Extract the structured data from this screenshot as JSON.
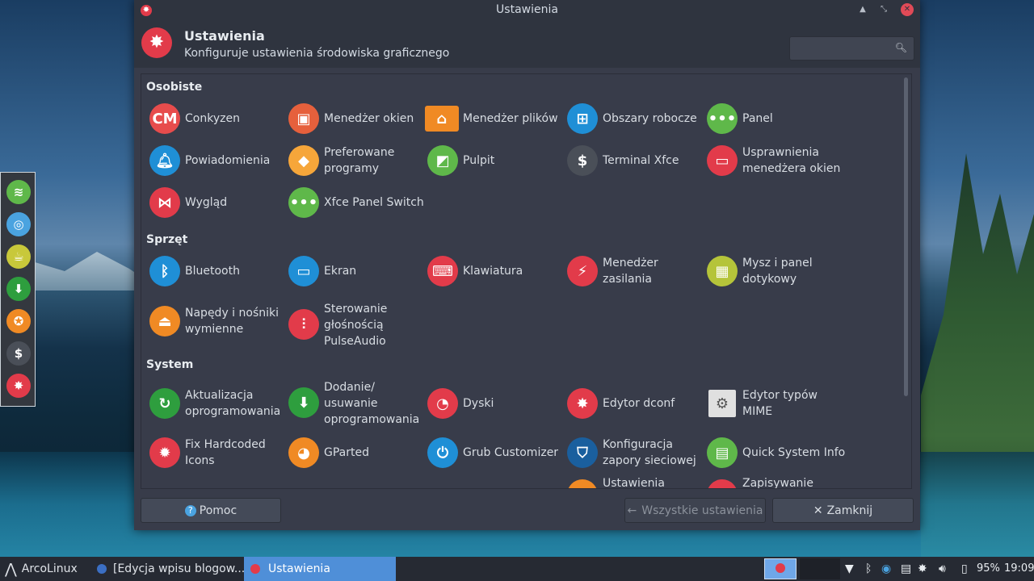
{
  "window": {
    "title": "Ustawienia",
    "header_title": "Ustawienia",
    "header_subtitle": "Konfiguruje ustawienia środowiska graficznego"
  },
  "search": {
    "placeholder": ""
  },
  "categories": [
    {
      "name": "Osobiste"
    },
    {
      "name": "Sprzęt"
    },
    {
      "name": "System"
    }
  ],
  "items": [
    {
      "label": "Conkyzen",
      "icon": "conkyzen-icon",
      "color": "#e74c4c"
    },
    {
      "label": "Menedżer okien",
      "icon": "window-manager-icon",
      "color": "#e6603c"
    },
    {
      "label": "Menedżer plików",
      "icon": "folder-icon",
      "color": "#f08a24"
    },
    {
      "label": "Obszary robocze",
      "icon": "workspaces-icon",
      "color": "#1f8fd6"
    },
    {
      "label": "Panel",
      "icon": "panel-icon",
      "color": "#5fb84a"
    },
    {
      "label": "Powiadomienia",
      "icon": "bell-icon",
      "color": "#1f8fd6"
    },
    {
      "label": "Preferowane programy",
      "icon": "diamond-icon",
      "color": "#f6a63a"
    },
    {
      "label": "Pulpit",
      "icon": "desktop-icon",
      "color": "#5fb84a"
    },
    {
      "label": "Terminal Xfce",
      "icon": "terminal-icon",
      "color": "#4a4f58"
    },
    {
      "label": "Usprawnienia menedżera okien",
      "icon": "window-tweaks-icon",
      "color": "#e23b4a"
    },
    {
      "label": "Wygląd",
      "icon": "bowtie-icon",
      "color": "#e23b4a"
    },
    {
      "label": "Xfce Panel Switch",
      "icon": "panel-switch-icon",
      "color": "#5fb84a"
    },
    {
      "label": "Bluetooth",
      "icon": "bluetooth-icon",
      "color": "#1f8fd6"
    },
    {
      "label": "Ekran",
      "icon": "monitor-icon",
      "color": "#1f8fd6"
    },
    {
      "label": "Klawiatura",
      "icon": "keyboard-icon",
      "color": "#e23b4a"
    },
    {
      "label": "Menedżer zasilania",
      "icon": "power-icon",
      "color": "#e23b4a"
    },
    {
      "label": "Mysz i panel dotykowy",
      "icon": "touchpad-icon",
      "color": "#b5c43a"
    },
    {
      "label": "Napędy i nośniki wymienne",
      "icon": "eject-icon",
      "color": "#f08a24"
    },
    {
      "label": "Sterowanie głośnością PulseAudio",
      "icon": "mixer-icon",
      "color": "#e23b4a"
    },
    {
      "label": "Aktualizacja oprogramowania",
      "icon": "update-icon",
      "color": "#2e9e3e"
    },
    {
      "label": "Dodanie/ usuwanie oprogramowania",
      "icon": "download-icon",
      "color": "#2e9e3e"
    },
    {
      "label": "Dyski",
      "icon": "disk-icon",
      "color": "#e23b4a"
    },
    {
      "label": "Edytor dconf",
      "icon": "gear-icon",
      "color": "#e23b4a"
    },
    {
      "label": "Edytor typów MIME",
      "icon": "mime-gear-icon",
      "color": "#e0e0e0"
    },
    {
      "label": "Fix Hardcoded Icons",
      "icon": "fix-icons-icon",
      "color": "#e23b4a"
    },
    {
      "label": "GParted",
      "icon": "gparted-icon",
      "color": "#f08a24"
    },
    {
      "label": "Grub Customizer",
      "icon": "grub-icon",
      "color": "#1f8fd6"
    },
    {
      "label": "Konfiguracja zapory sieciowej",
      "icon": "shield-icon",
      "color": "#1a5f9e"
    },
    {
      "label": "Quick System Info",
      "icon": "system-info-icon",
      "color": "#5fb84a"
    },
    {
      "label": "Ustawienia",
      "icon": "settings-icon",
      "color": "#f08a24"
    },
    {
      "label": "Zapisywanie",
      "icon": "save-icon",
      "color": "#e23b4a"
    }
  ],
  "footer": {
    "help": "Pomoc",
    "all_settings": "Wszystkie ustawienia",
    "close": "Zamknij"
  },
  "taskbar": {
    "menu": "ArcoLinux",
    "task1": "[Edycja wpisu blogow...",
    "task2": "Ustawienia",
    "battery": "95%",
    "clock": "19:09"
  },
  "dock": [
    {
      "icon": "spotify-icon",
      "color": "#5fb84a"
    },
    {
      "icon": "chromium-icon",
      "color": "#4aa3e0"
    },
    {
      "icon": "teapot-icon",
      "color": "#c8c83a"
    },
    {
      "icon": "download-icon",
      "color": "#2e9e3e"
    },
    {
      "icon": "lifebuoy-icon",
      "color": "#f08a24"
    },
    {
      "icon": "terminal-icon",
      "color": "#4a4f58"
    },
    {
      "icon": "settings-icon",
      "color": "#e23b4a"
    }
  ]
}
